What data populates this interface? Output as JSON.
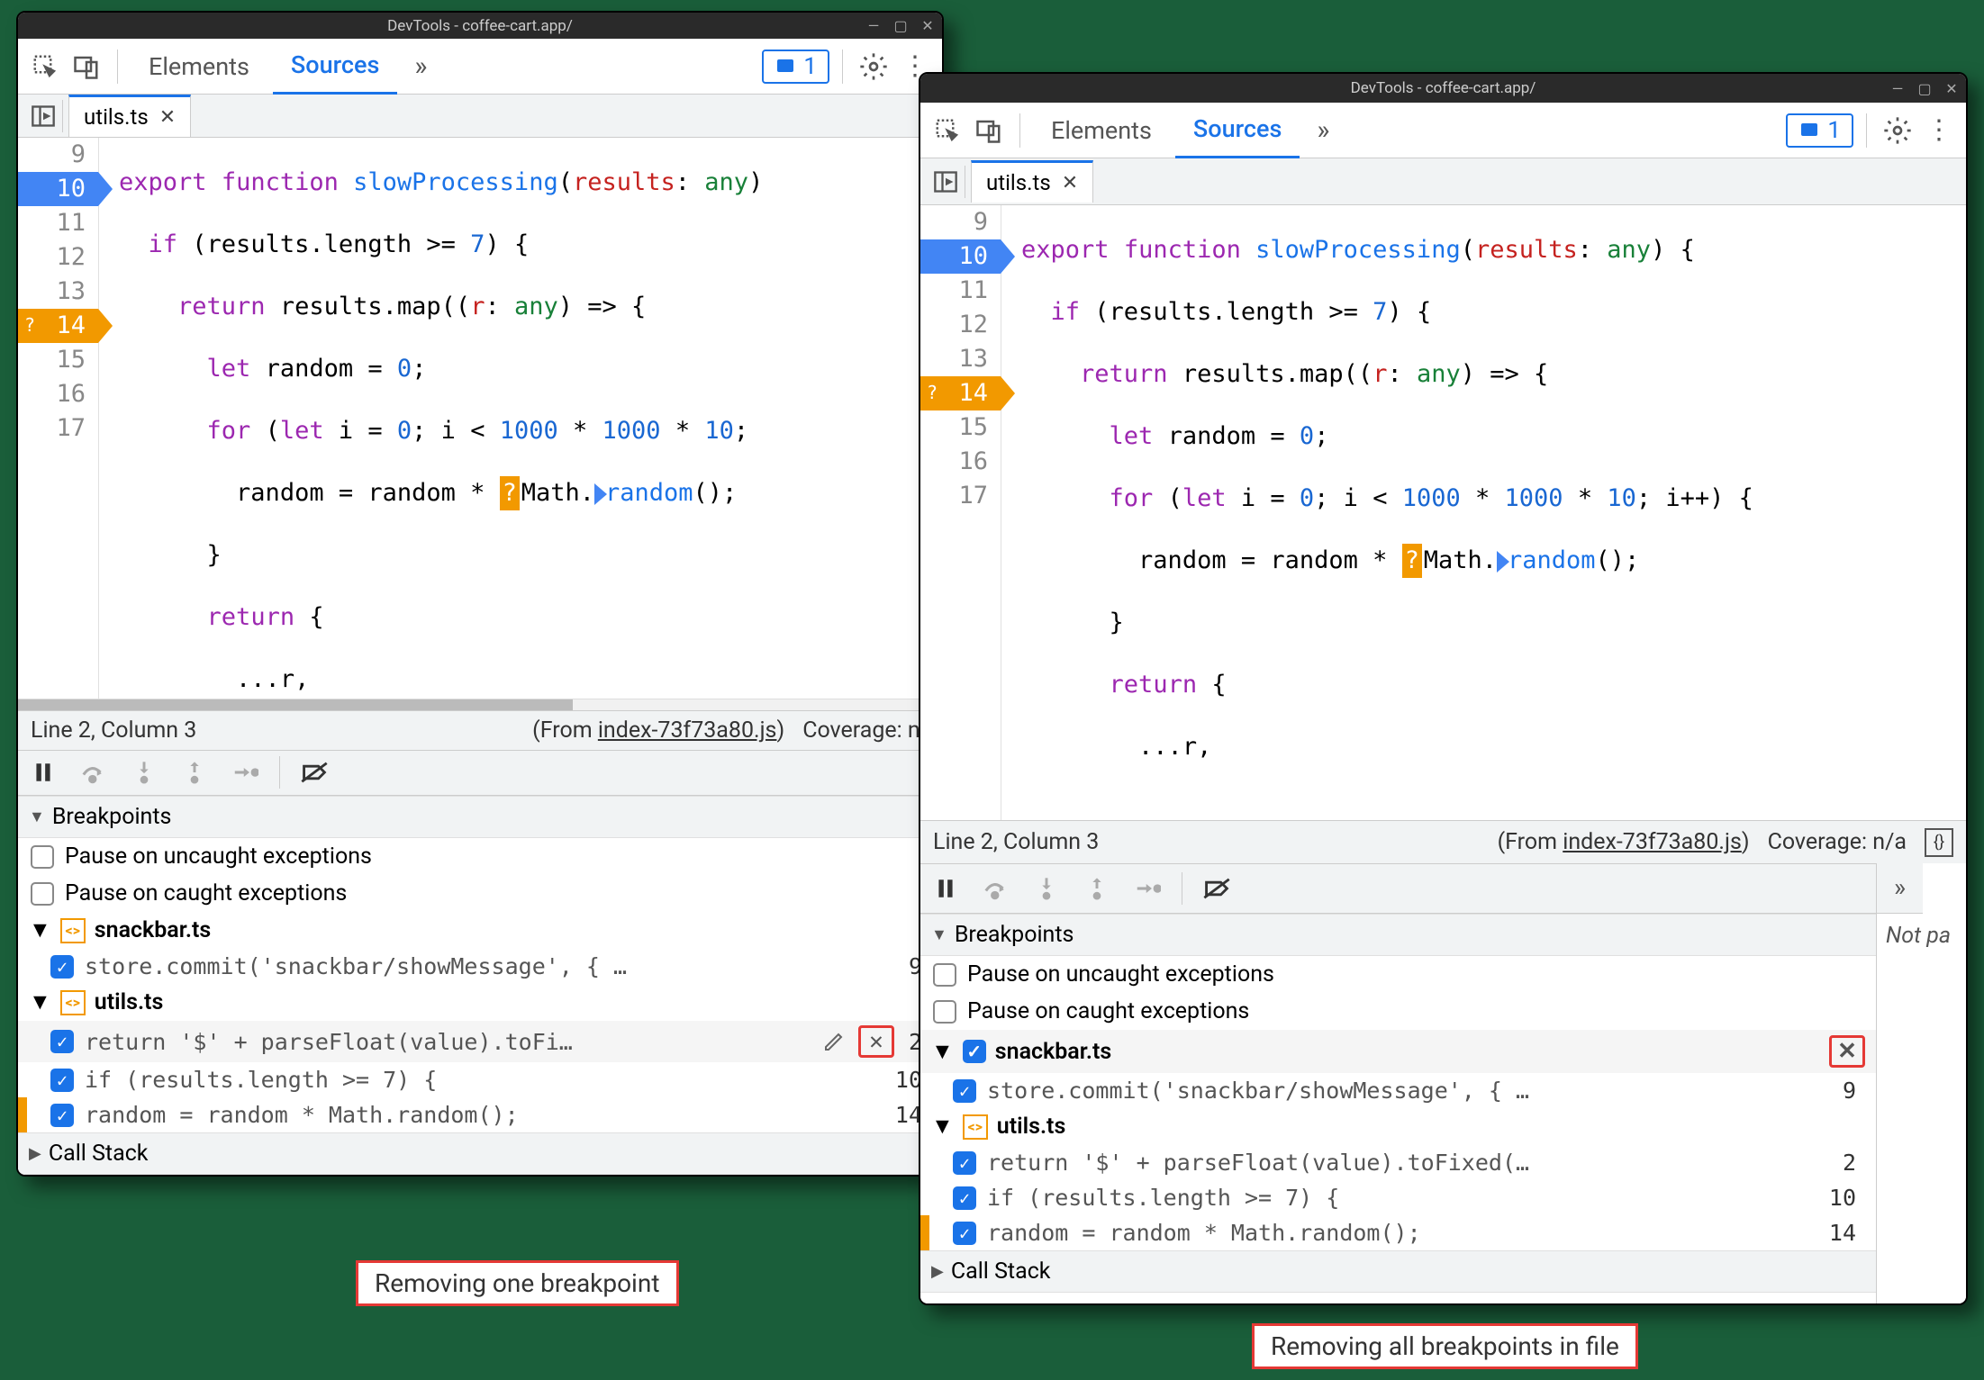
{
  "titlebar": {
    "title": "DevTools - coffee-cart.app/"
  },
  "toolbar": {
    "tabs": {
      "elements": "Elements",
      "sources": "Sources"
    },
    "issue_count": "1"
  },
  "filetab": {
    "name": "utils.ts"
  },
  "code": {
    "lines": {
      "l9": {
        "n": "9"
      },
      "l10": {
        "n": "10"
      },
      "l11": {
        "n": "11"
      },
      "l12": {
        "n": "12"
      },
      "l13": {
        "n": "13"
      },
      "l14": {
        "n": "14"
      },
      "l15": {
        "n": "15"
      },
      "l16": {
        "n": "16"
      },
      "l17": {
        "n": "17"
      }
    },
    "tokens": {
      "export": "export",
      "function": "function",
      "slowProcessing": "slowProcessing",
      "results": "results",
      "any": "any",
      "if": "if",
      "return": "return",
      "let": "let",
      "for": "for",
      "n0": "0",
      "n7": "7",
      "n1000": "1000",
      "n10": "10",
      "math": "Math.",
      "random": "random",
      "length": ".length",
      "map": ".map",
      "r": "r",
      "ipp": "i++",
      "spread_r": "...r,"
    }
  },
  "status": {
    "position": "Line 2, Column 3",
    "from_label": "(From ",
    "from_file": "index-73f73a80.js",
    "close_paren": ")",
    "cov_left": "Coverage: n/",
    "cov_right": "Coverage: n/a"
  },
  "breakpoints": {
    "title": "Breakpoints",
    "uncaught": "Pause on uncaught exceptions",
    "caught": "Pause on caught exceptions",
    "files": {
      "snackbar": {
        "name": "snackbar.ts",
        "items": [
          {
            "code": "store.commit('snackbar/showMessage', { …",
            "line": "9"
          }
        ]
      },
      "utils": {
        "name": "utils.ts",
        "items": [
          {
            "code_left": "return '$' + parseFloat(value).toFi…",
            "code_right": "return '$' + parseFloat(value).toFixed(…",
            "line": "2"
          },
          {
            "code": "if (results.length >= 7) {",
            "line": "10"
          },
          {
            "code": "random = random * Math.random();",
            "line": "14"
          }
        ]
      }
    }
  },
  "callstack": {
    "title": "Call Stack"
  },
  "right_panel": {
    "notpa": "Not pa"
  },
  "captions": {
    "left": "Removing one breakpoint",
    "right": "Removing all breakpoints in file"
  }
}
